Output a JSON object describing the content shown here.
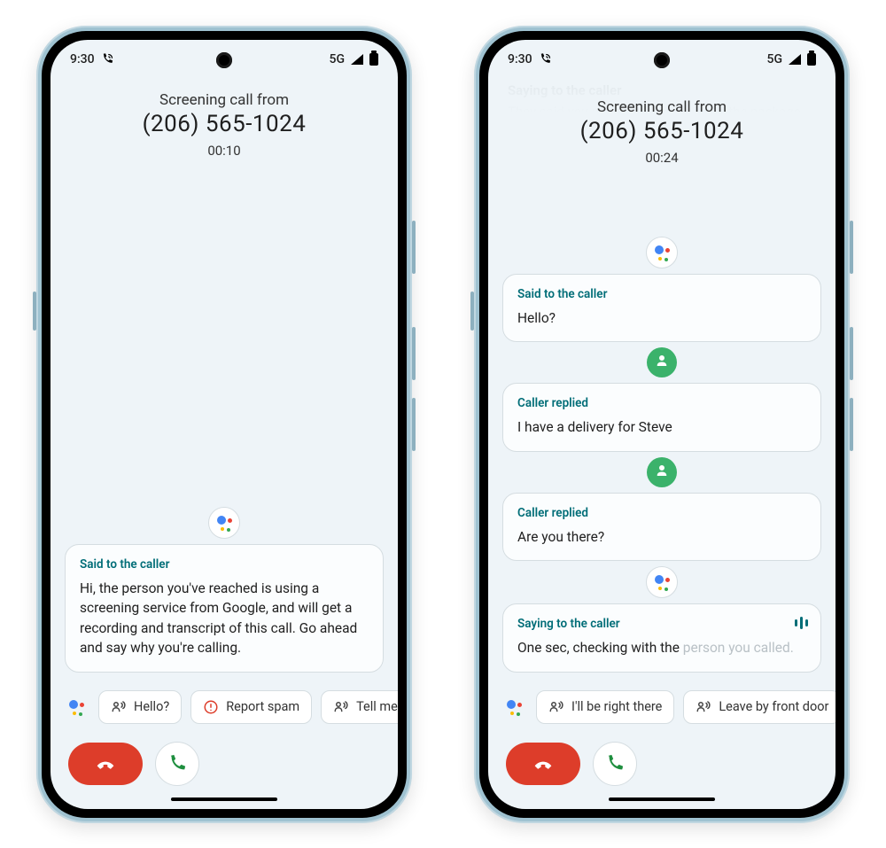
{
  "status": {
    "time": "9:30",
    "network": "5G"
  },
  "phone1": {
    "header": {
      "line1": "Screening call from",
      "number": "(206) 565-1024",
      "timer": "00:10"
    },
    "card": {
      "label": "Said to the caller",
      "text": "Hi, the person you've reached is using a screening service from Google, and will get a recording and transcript of this call. Go ahead and say why you're calling."
    },
    "chips": {
      "c1": "Hello?",
      "c2": "Report spam",
      "c3": "Tell me mo"
    }
  },
  "phone2": {
    "ghost": {
      "l1": "Saying to the caller",
      "l2": "They said you weren't home, so leave the package by"
    },
    "header": {
      "line1": "Screening call from",
      "number": "(206) 565-1024",
      "timer": "00:24"
    },
    "cards": {
      "c1": {
        "label": "Said to the caller",
        "text": "Hello?"
      },
      "c2": {
        "label": "Caller replied",
        "text": "I have a delivery for Steve"
      },
      "c3": {
        "label": "Caller replied",
        "text": "Are you there?"
      },
      "c4": {
        "label": "Saying to the caller",
        "text_a": "One sec, checking with the ",
        "text_b": "person you called."
      }
    },
    "chips": {
      "c1": "I'll be right there",
      "c2": "Leave by front door"
    }
  }
}
